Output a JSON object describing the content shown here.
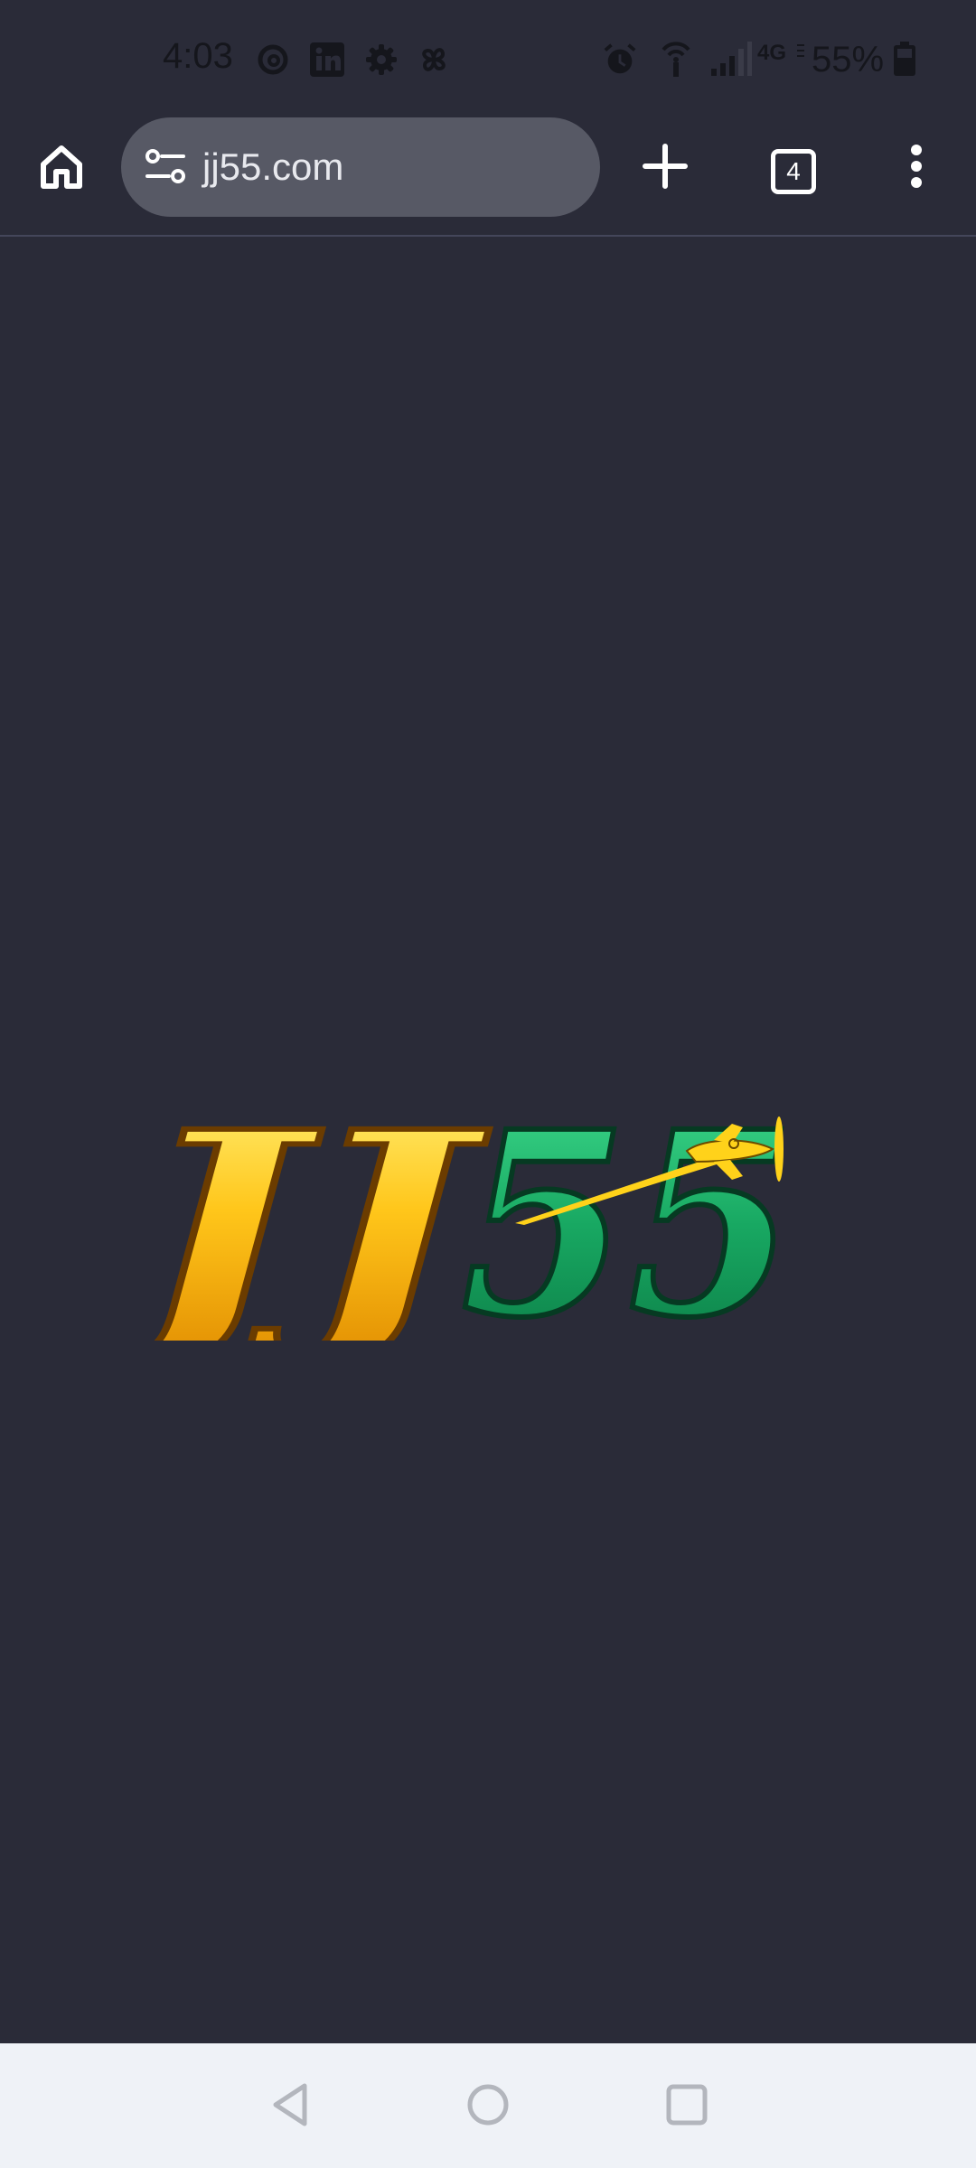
{
  "status_bar": {
    "time": "4:03",
    "notification_icons": [
      "threads-icon",
      "linkedin-icon",
      "settings-icon",
      "pinwheel-icon"
    ],
    "system_icons": [
      "alarm-icon",
      "hotspot-icon",
      "signal-icon",
      "4g-icon"
    ],
    "network_label": "4G",
    "battery_percent": "55%"
  },
  "browser": {
    "url": "jj55.com",
    "tab_count": "4"
  },
  "page": {
    "logo_text": "JJ55"
  },
  "colors": {
    "background": "#2a2b38",
    "url_bar": "#575965",
    "logo_gold": "#f5b400",
    "logo_green": "#1aa866",
    "nav_bar": "#eff2f7"
  }
}
